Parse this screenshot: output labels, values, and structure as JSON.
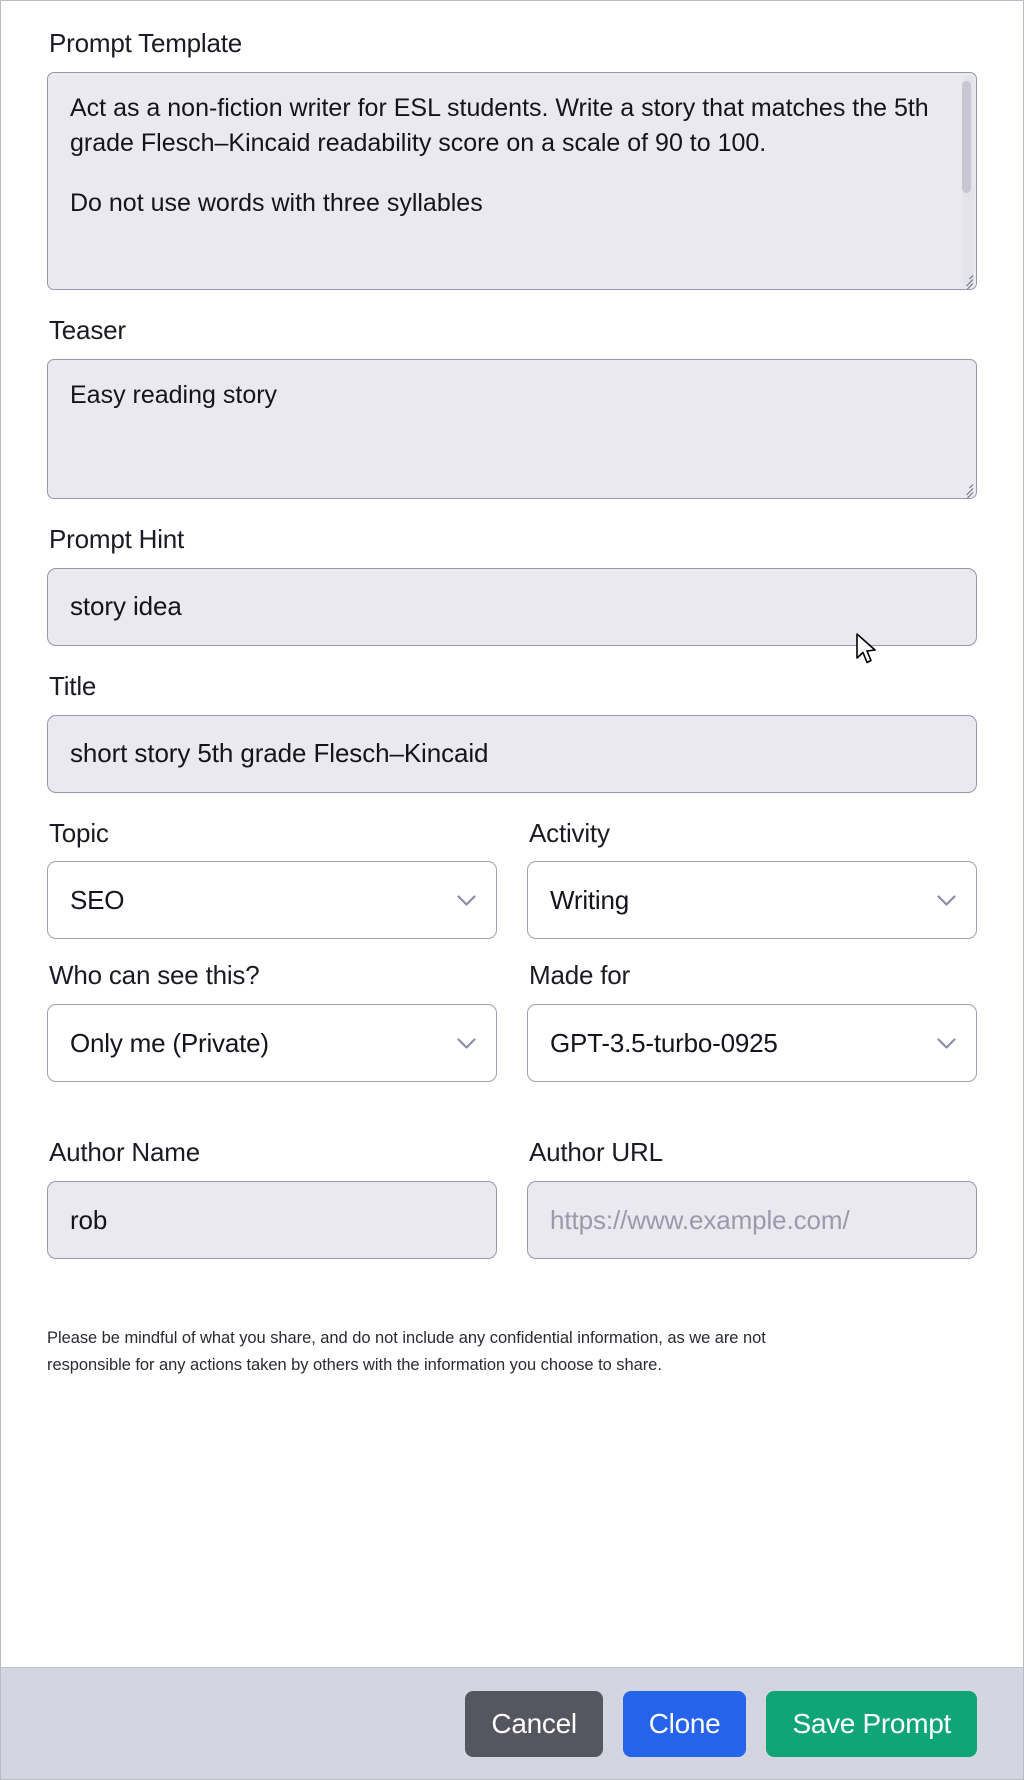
{
  "form": {
    "prompt_template": {
      "label": "Prompt Template",
      "paragraph_1": "Act as a non-fiction writer for ESL students. Write a story that matches the 5th grade Flesch–Kincaid readability score on a scale of 90 to 100.",
      "paragraph_2": "Do not use words with three syllables"
    },
    "teaser": {
      "label": "Teaser",
      "value": "Easy reading story"
    },
    "prompt_hint": {
      "label": "Prompt Hint",
      "value": "story idea"
    },
    "title": {
      "label": "Title",
      "value": "short story 5th grade Flesch–Kincaid"
    },
    "topic": {
      "label": "Topic",
      "value": "SEO"
    },
    "activity": {
      "label": "Activity",
      "value": "Writing"
    },
    "visibility": {
      "label": "Who can see this?",
      "value": "Only me (Private)"
    },
    "made_for": {
      "label": "Made for",
      "value": "GPT-3.5-turbo-0925"
    },
    "author_name": {
      "label": "Author Name",
      "value": "rob"
    },
    "author_url": {
      "label": "Author URL",
      "placeholder": "https://www.example.com/",
      "value": ""
    },
    "disclaimer": "Please be mindful of what you share, and do not include any confidential information, as we are not responsible for any actions taken by others with the information you choose to share."
  },
  "footer": {
    "cancel_label": "Cancel",
    "clone_label": "Clone",
    "save_label": "Save Prompt"
  },
  "colors": {
    "cancel": "#55565f",
    "clone": "#2563eb",
    "save": "#10a577",
    "footer_bg": "#d3d5e1",
    "field_bg": "#e9e9ef",
    "field_border": "#9699ad"
  }
}
